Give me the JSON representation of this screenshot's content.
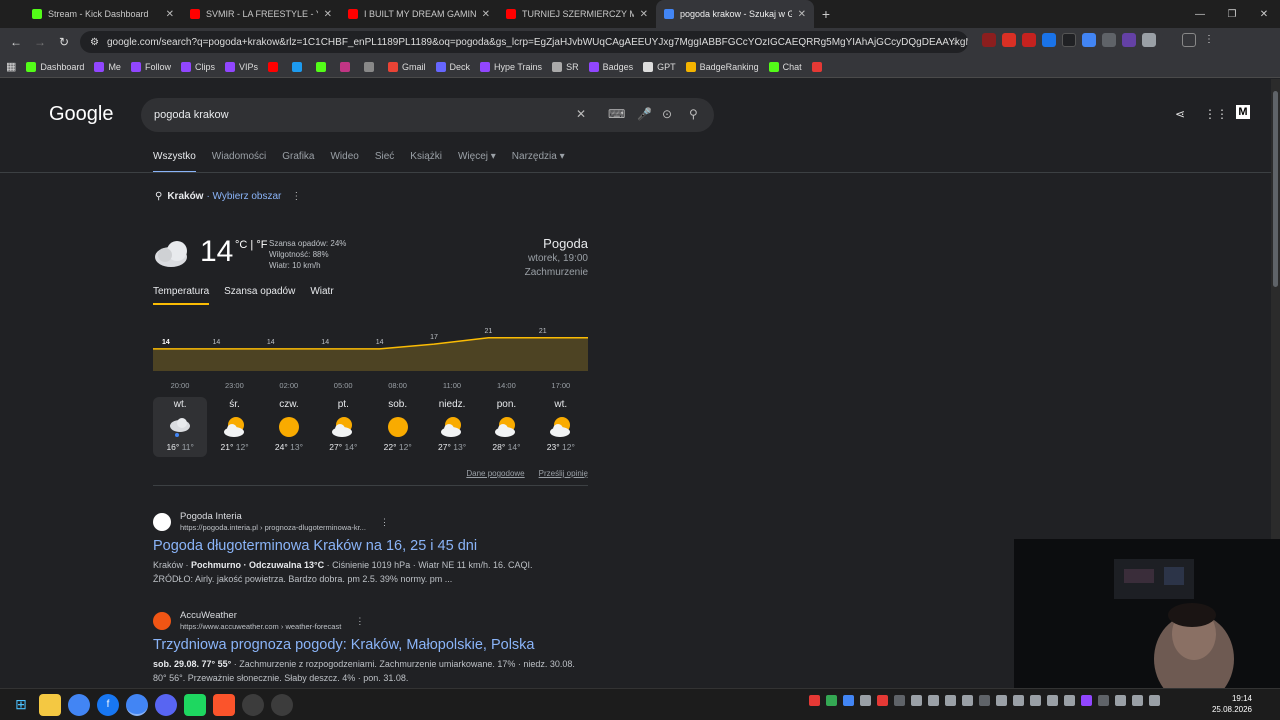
{
  "tabs": [
    {
      "title": "Stream - Kick Dashboard",
      "color": "#53fc18"
    },
    {
      "title": "SVMIR - LA FREESTYLE - YouTu",
      "color": "#ff0000"
    },
    {
      "title": "I BUILT MY DREAM GAMING R",
      "color": "#ff0000"
    },
    {
      "title": "TURNIEJ SZERMIERCZY MIĘCZ",
      "color": "#ff0000"
    },
    {
      "title": "pogoda krakow - Szukaj w Goo",
      "color": "#4285f4",
      "active": true
    }
  ],
  "address": {
    "url": "google.com/search?q=pogoda+krakow&rlz=1C1CHBF_enPL1189PL1189&oq=pogoda&gs_lcrp=EgZjaHJvbWUqCAgAEEUYJxg7MggIABBFGCcYOzIGCAEQRRg5MgYIAhAjGCcyDQgDEAAYkgMYgAQYigU..."
  },
  "bookmarks": [
    {
      "label": "Dashboard",
      "color": "#53fc18"
    },
    {
      "label": "Me",
      "color": "#9146ff"
    },
    {
      "label": "Follow",
      "color": "#9146ff"
    },
    {
      "label": "Clips",
      "color": "#9146ff"
    },
    {
      "label": "VIPs",
      "color": "#9146ff"
    },
    {
      "label": "",
      "color": "#ff0000"
    },
    {
      "label": "",
      "color": "#1d9bf0"
    },
    {
      "label": "",
      "color": "#53fc18"
    },
    {
      "label": "",
      "color": "#c13584"
    },
    {
      "label": "",
      "color": "#888888"
    },
    {
      "label": "Gmail",
      "color": "#ea4335"
    },
    {
      "label": "Deck",
      "color": "#6666ff"
    },
    {
      "label": "Hype Trains",
      "color": "#9146ff"
    },
    {
      "label": "SR",
      "color": "#aaaaaa"
    },
    {
      "label": "Badges",
      "color": "#9146ff"
    },
    {
      "label": "GPT",
      "color": "#dddddd"
    },
    {
      "label": "BadgeRanking",
      "color": "#f4b400"
    },
    {
      "label": "Chat",
      "color": "#53fc18"
    },
    {
      "label": "",
      "color": "#e53935"
    }
  ],
  "google": {
    "logo": "Google",
    "query": "pogoda krakow",
    "nav": [
      "Wszystko",
      "Wiadomości",
      "Grafika",
      "Wideo",
      "Sieć",
      "Książki",
      "Więcej ▾",
      "Narzędzia ▾"
    ]
  },
  "location": {
    "city": "Kraków",
    "change": "· Wybierz obszar"
  },
  "weather": {
    "temp": "14",
    "units": "°C | °F",
    "rain": "Szansa opadów: 24%",
    "humidity": "Wilgotność: 88%",
    "wind": "Wiatr: 10 km/h",
    "title": "Pogoda",
    "time": "wtorek, 19:00",
    "cond": "Zachmurzenie",
    "tabs": [
      "Temperatura",
      "Szansa opadów",
      "Wiatr"
    ],
    "links": [
      "Dane pogodowe",
      "Prześlij opinię"
    ],
    "days": [
      {
        "name": "wt.",
        "hi": "16°",
        "lo": "11°",
        "icon": "rain-cloud-icon"
      },
      {
        "name": "śr.",
        "hi": "21°",
        "lo": "12°",
        "icon": "partly-cloudy-icon"
      },
      {
        "name": "czw.",
        "hi": "24°",
        "lo": "13°",
        "icon": "sun-icon"
      },
      {
        "name": "pt.",
        "hi": "27°",
        "lo": "14°",
        "icon": "partly-cloudy-icon"
      },
      {
        "name": "sob.",
        "hi": "22°",
        "lo": "12°",
        "icon": "sun-icon"
      },
      {
        "name": "niedz.",
        "hi": "27°",
        "lo": "13°",
        "icon": "partly-cloudy-icon"
      },
      {
        "name": "pon.",
        "hi": "28°",
        "lo": "14°",
        "icon": "partly-cloudy-icon"
      },
      {
        "name": "wt.",
        "hi": "23°",
        "lo": "12°",
        "icon": "partly-cloudy-icon"
      }
    ]
  },
  "chart_data": {
    "type": "area",
    "x": [
      "20:00",
      "23:00",
      "02:00",
      "05:00",
      "08:00",
      "11:00",
      "14:00",
      "17:00"
    ],
    "values": [
      14,
      14,
      14,
      14,
      14,
      17,
      21,
      21
    ],
    "ylim": [
      0,
      24
    ],
    "color": "#fbbc04"
  },
  "results": [
    {
      "site": "Pogoda Interia",
      "url": "https://pogoda.interia.pl › prognoza-dlugoterminowa-kr...",
      "title": "Pogoda długoterminowa Kraków na 16, 25 i 45 dni",
      "line1a": "Kraków · ",
      "line1b": "Pochmurno · Odczuwalna 13°C",
      "line1c": " · Ciśnienie 1019 hPa · Wiatr NE 11 km/h. 16. CAQI.",
      "line2": "ŹRÓDŁO: Airly. jakość powietrza. Bardzo dobra. pm 2.5. 39% normy. pm ..."
    },
    {
      "site": "AccuWeather",
      "url": "https://www.accuweather.com › weather-forecast",
      "title": "Trzydniowa prognoza pogody: Kraków, Małopolskie, Polska",
      "line1a": "",
      "line1b": "sob. 29.08. 77° 55°",
      "line1c": " · Zachmurzenie z rozpogodzeniami. Zachmurzenie umiarkowane. 17% · niedz. 30.08.",
      "line2": "80° 56°. Przeważnie słonecznie. Słaby deszcz. 4% · pon. 31.08."
    }
  ],
  "clock": {
    "time": "19:14",
    "date": "25.08.2026"
  }
}
